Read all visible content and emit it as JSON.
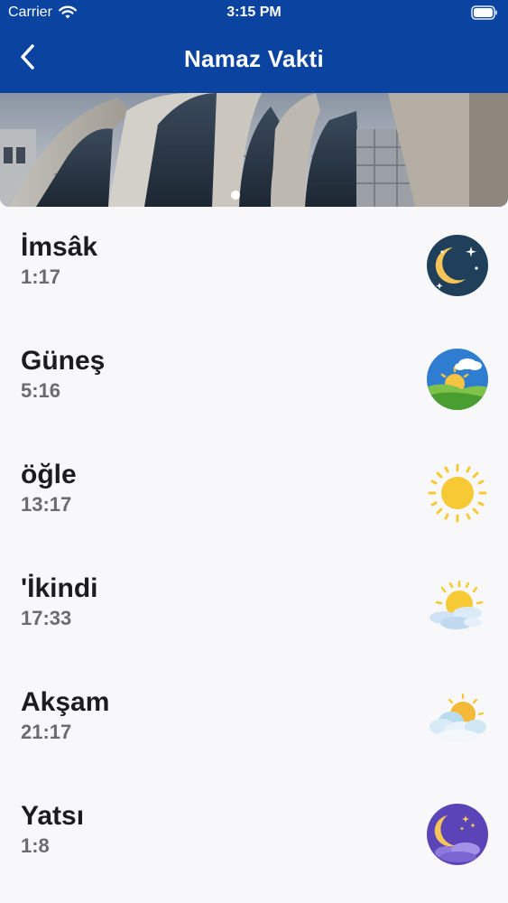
{
  "status_bar": {
    "carrier": "Carrier",
    "time": "3:15 PM"
  },
  "nav": {
    "title": "Namaz Vakti"
  },
  "banner": {
    "page_count_visible": 1
  },
  "colors": {
    "header": "#0b44a0",
    "background": "#f8f8fa",
    "name_text": "#1c1c1e",
    "time_text": "#6c6c70"
  },
  "prayers": [
    {
      "name": "İmsâk",
      "time": "1:17",
      "icon": "crescent-moon-night-icon"
    },
    {
      "name": "Güneş",
      "time": "5:16",
      "icon": "sunrise-landscape-icon"
    },
    {
      "name": "öğle",
      "time": "13:17",
      "icon": "sun-icon"
    },
    {
      "name": "'İkindi",
      "time": "17:33",
      "icon": "sun-behind-cloud-icon"
    },
    {
      "name": "Akşam",
      "time": "21:17",
      "icon": "sunset-cloud-icon"
    },
    {
      "name": "Yatsı",
      "time": "1:8",
      "icon": "moon-stars-clouds-icon"
    }
  ]
}
